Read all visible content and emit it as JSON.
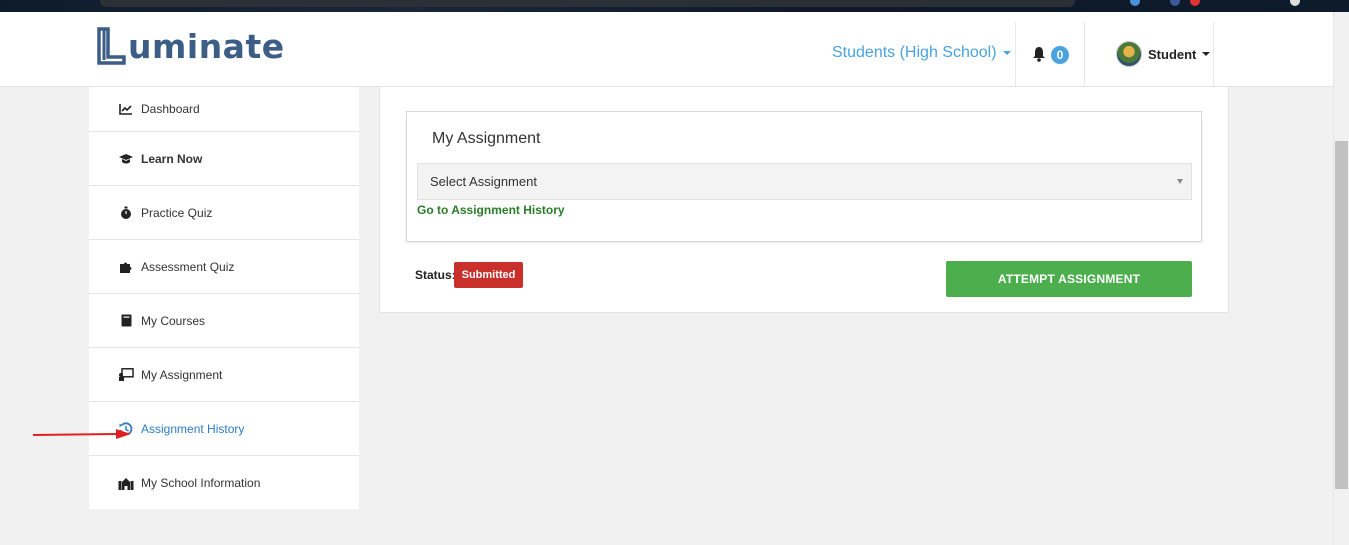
{
  "header": {
    "logo_text": "uminate",
    "role_select": "Students (High School)",
    "notification_count": "0",
    "user_name": "Student"
  },
  "sidebar": {
    "items": [
      {
        "label": "Dashboard",
        "icon": "chart-line-icon"
      },
      {
        "label": "Learn Now",
        "icon": "graduation-cap-icon"
      },
      {
        "label": "Practice Quiz",
        "icon": "stopwatch-icon"
      },
      {
        "label": "Assessment Quiz",
        "icon": "puzzle-icon"
      },
      {
        "label": "My Courses",
        "icon": "book-icon"
      },
      {
        "label": "My Assignment",
        "icon": "teacher-board-icon"
      },
      {
        "label": "Assignment History",
        "icon": "history-icon"
      },
      {
        "label": "My School Information",
        "icon": "school-icon"
      }
    ]
  },
  "main": {
    "card_title": "My Assignment",
    "select_placeholder": "Select Assignment",
    "history_link": "Go to Assignment History",
    "status_label": "Status:",
    "status_value": "Submitted",
    "attempt_button": "ATTEMPT ASSIGNMENT"
  },
  "colors": {
    "accent": "#4aa3df",
    "active_link": "#2e7bc4",
    "success": "#4cae4c",
    "danger": "#c9302c",
    "link_green": "#2a7d2a"
  }
}
